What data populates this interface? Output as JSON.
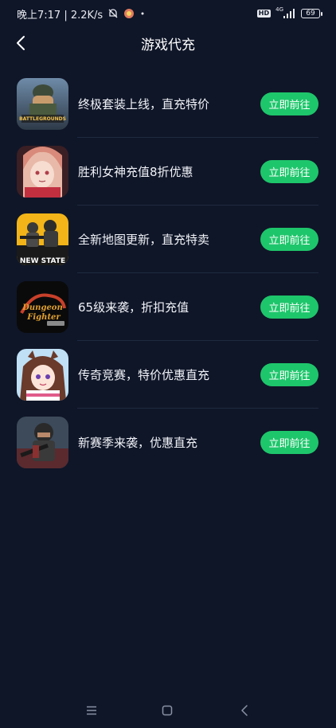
{
  "status_bar": {
    "time_text": "晚上7:17 | 2.2K/s",
    "hd_label": "HD",
    "network_label": "4G",
    "battery_level": "69"
  },
  "header": {
    "title": "游戏代充"
  },
  "games": [
    {
      "description": "终极套装上线，直充特价",
      "button_label": "立即前往",
      "icon_name": "pubg-battlegrounds-icon"
    },
    {
      "description": "胜利女神充值8折优惠",
      "button_label": "立即前往",
      "icon_name": "goddess-of-victory-icon"
    },
    {
      "description": "全新地图更新，直充特卖",
      "button_label": "立即前往",
      "icon_name": "pubg-new-state-icon"
    },
    {
      "description": "65级来袭，折扣充值",
      "button_label": "立即前往",
      "icon_name": "dungeon-fighter-icon"
    },
    {
      "description": "传奇竞赛，特价优惠直充",
      "button_label": "立即前往",
      "icon_name": "umamusume-icon"
    },
    {
      "description": "新赛季来袭，优惠直充",
      "button_label": "立即前往",
      "icon_name": "tactical-shooter-icon"
    }
  ],
  "colors": {
    "background": "#0f1628",
    "accent": "#1ec66b"
  }
}
